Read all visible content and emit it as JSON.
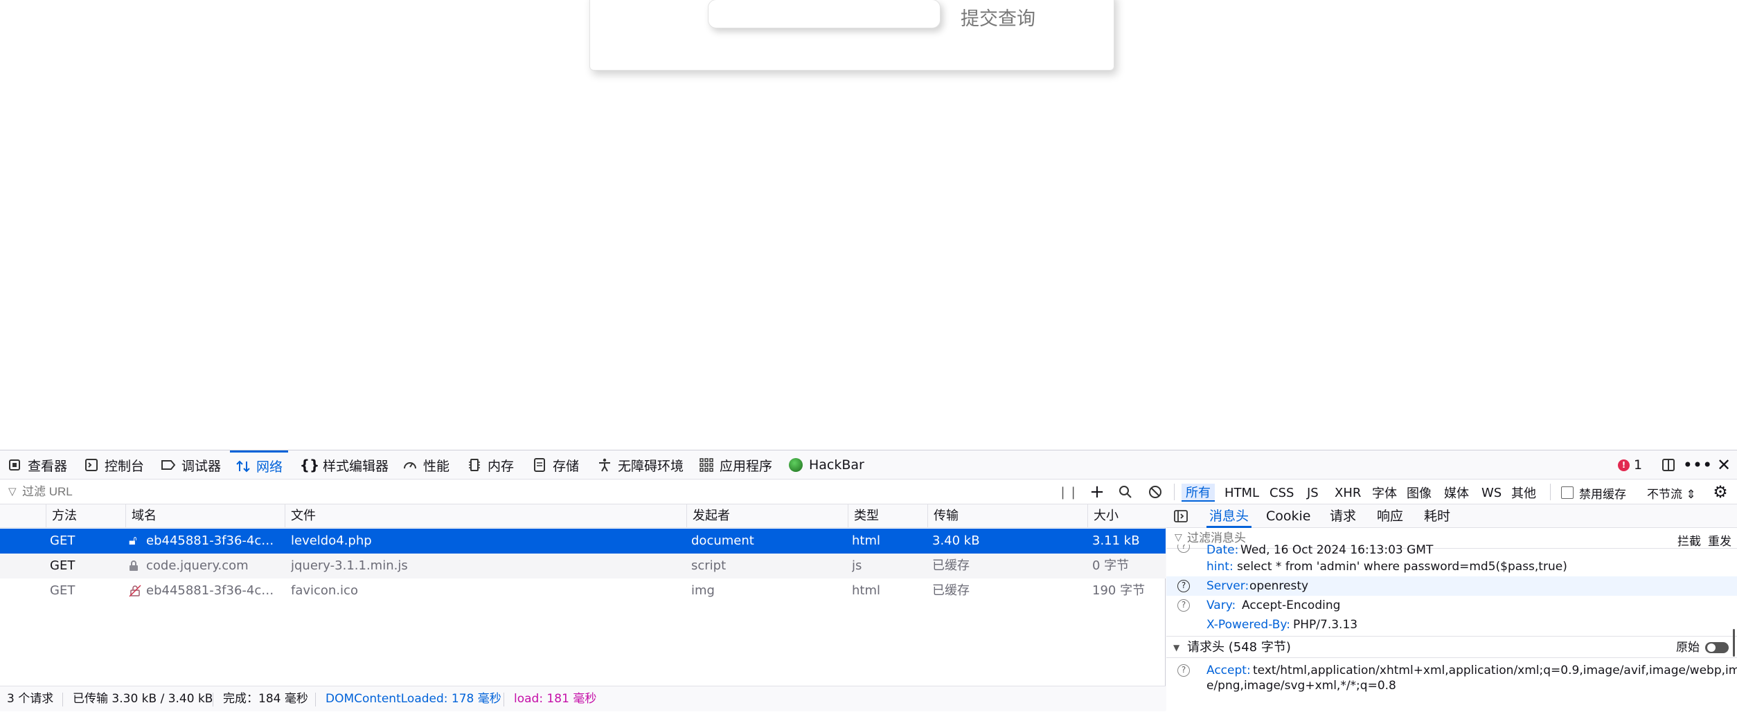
{
  "page": {
    "submit_label": "提交查询"
  },
  "devtools": {
    "tabs": [
      {
        "label": "查看器",
        "icon": "inspector-icon"
      },
      {
        "label": "控制台",
        "icon": "console-icon"
      },
      {
        "label": "调试器",
        "icon": "debugger-icon"
      },
      {
        "label": "网络",
        "icon": "network-icon",
        "active": true
      },
      {
        "label": "样式编辑器",
        "icon": "style-editor-icon"
      },
      {
        "label": "性能",
        "icon": "performance-icon"
      },
      {
        "label": "内存",
        "icon": "memory-icon"
      },
      {
        "label": "存储",
        "icon": "storage-icon"
      },
      {
        "label": "无障碍环境",
        "icon": "accessibility-icon"
      },
      {
        "label": "应用程序",
        "icon": "application-icon"
      },
      {
        "label": "HackBar",
        "icon": "hackbar-icon"
      }
    ],
    "error_count": "1",
    "filter_placeholder": "过滤 URL",
    "type_filters": [
      "所有",
      "HTML",
      "CSS",
      "JS",
      "XHR",
      "字体",
      "图像",
      "媒体",
      "WS",
      "其他"
    ],
    "disable_cache_label": "禁用缓存",
    "throttle_label": "不节流",
    "columns": [
      "方法",
      "域名",
      "文件",
      "发起者",
      "类型",
      "传输",
      "大小"
    ],
    "requests": [
      {
        "method": "GET",
        "domain": "eb445881-3f36-4c45-...",
        "file": "leveldo4.php",
        "initiator": "document",
        "type": "html",
        "transferred": "3.40 kB",
        "size": "3.11 kB"
      },
      {
        "method": "GET",
        "domain": "code.jquery.com",
        "file": "jquery-3.1.1.min.js",
        "initiator": "script",
        "type": "js",
        "transferred": "已缓存",
        "size": "0 字节"
      },
      {
        "method": "GET",
        "domain": "eb445881-3f36-4c45-...",
        "file": "favicon.ico",
        "initiator": "img",
        "type": "html",
        "transferred": "已缓存",
        "size": "190 字节"
      }
    ],
    "status": {
      "requests": "3 个请求",
      "transferred": "已传输 3.30 kB / 3.40 kB",
      "finish": "完成：184 毫秒",
      "dcl": "DOMContentLoaded: 178 毫秒",
      "load": "load: 181 毫秒"
    },
    "details": {
      "tabs": [
        "消息头",
        "Cookie",
        "请求",
        "响应",
        "耗时"
      ],
      "filter_placeholder": "过滤消息头",
      "block_label": "拦截",
      "resend_label": "重发",
      "response_headers": [
        {
          "key": "Date:",
          "value": "Wed, 16 Oct 2024 16:13:03 GMT"
        },
        {
          "key": "hint:",
          "value": "select * from 'admin' where password=md5($pass,true)"
        },
        {
          "key": "Server:",
          "value": "openresty"
        },
        {
          "key": "Vary:",
          "value": "Accept-Encoding"
        },
        {
          "key": "X-Powered-By:",
          "value": "PHP/7.3.13"
        }
      ],
      "request_section": "请求头 (548 字节)",
      "raw_label": "原始",
      "accept_key": "Accept:",
      "accept_value": "text/html,application/xhtml+xml,application/xml;q=0.9,image/avif,image/webp,imag",
      "accept_value_2": "e/png,image/svg+xml,*/*;q=0.8"
    }
  }
}
